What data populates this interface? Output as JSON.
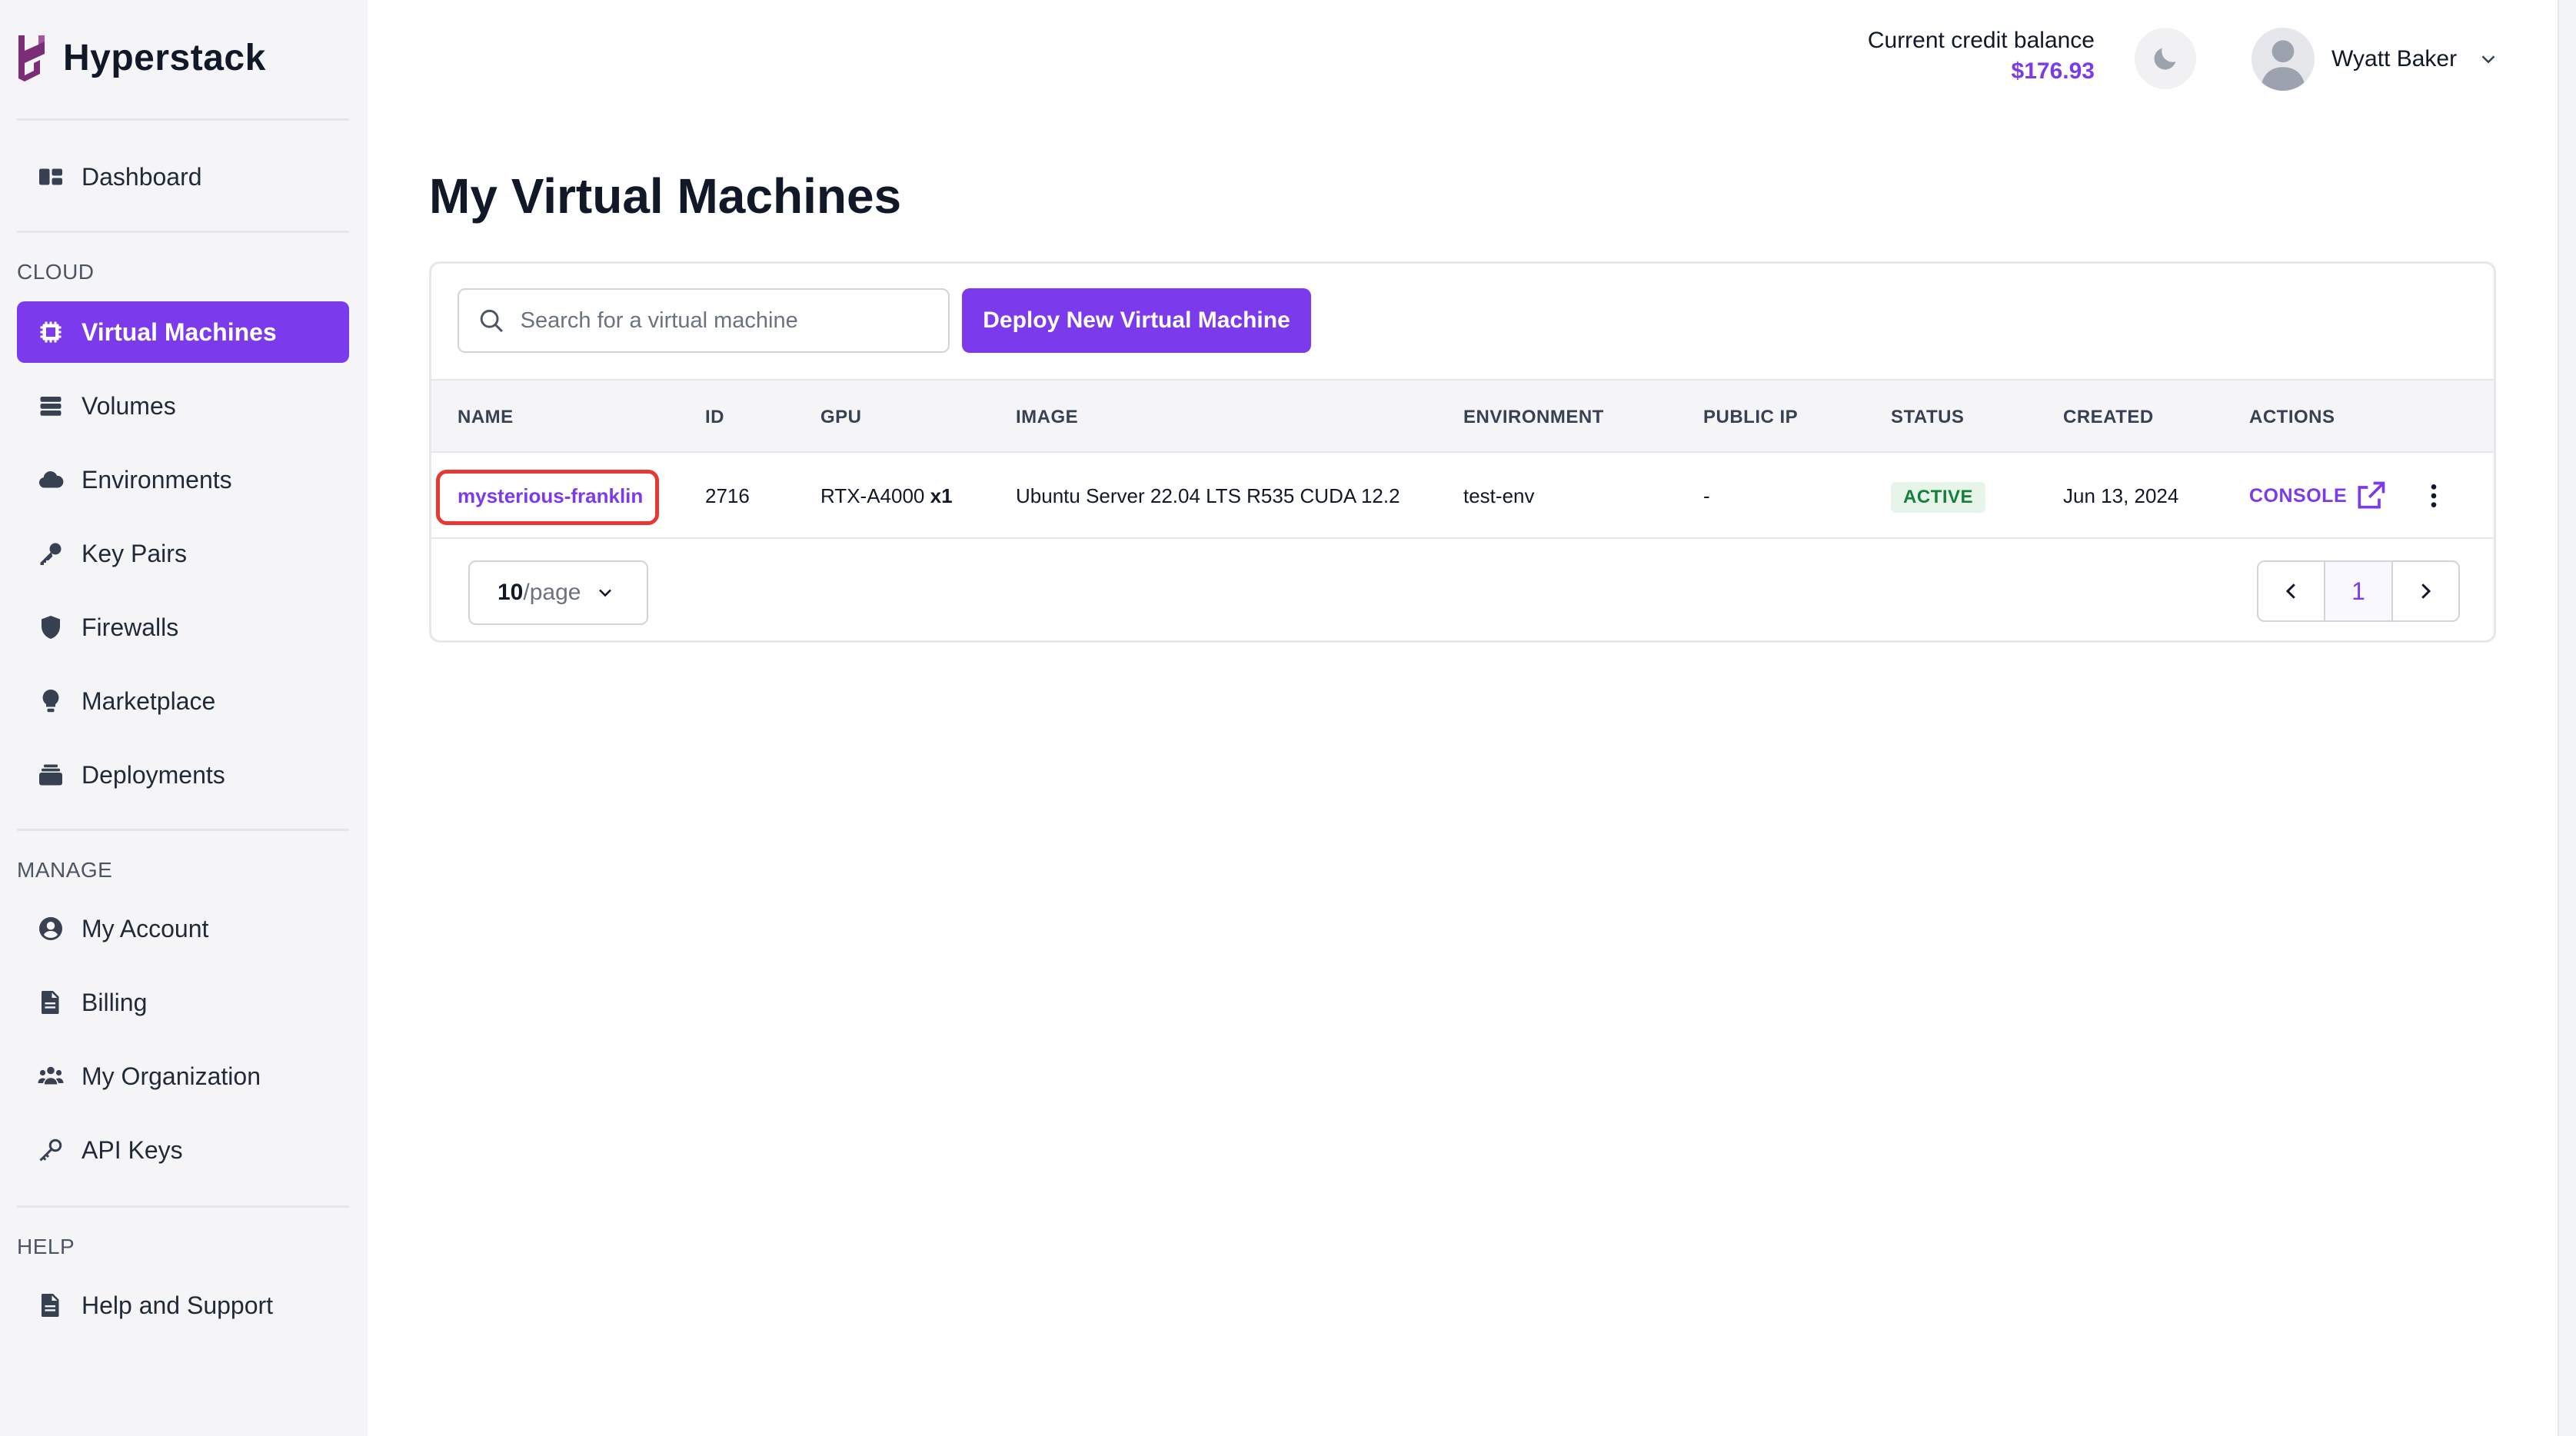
{
  "app": {
    "name": "Hyperstack"
  },
  "sidebar": {
    "sections": {
      "cloud": "CLOUD",
      "manage": "MANAGE",
      "help": "HELP"
    },
    "items": [
      {
        "label": "Dashboard",
        "icon": "dashboard-icon"
      },
      {
        "label": "Virtual Machines",
        "icon": "chip-icon",
        "active": true
      },
      {
        "label": "Volumes",
        "icon": "database-icon"
      },
      {
        "label": "Environments",
        "icon": "cloud-icon"
      },
      {
        "label": "Key Pairs",
        "icon": "key-icon"
      },
      {
        "label": "Firewalls",
        "icon": "shield-icon"
      },
      {
        "label": "Marketplace",
        "icon": "lightbulb-icon"
      },
      {
        "label": "Deployments",
        "icon": "layers-icon"
      },
      {
        "label": "My Account",
        "icon": "user-circle-icon"
      },
      {
        "label": "Billing",
        "icon": "document-icon"
      },
      {
        "label": "My Organization",
        "icon": "users-icon"
      },
      {
        "label": "API Keys",
        "icon": "key-outline-icon"
      },
      {
        "label": "Help and Support",
        "icon": "document-icon"
      }
    ]
  },
  "header": {
    "credit_label": "Current credit balance",
    "credit_value": "$176.93",
    "user_name": "Wyatt Baker"
  },
  "main": {
    "title": "My Virtual Machines",
    "search_placeholder": "Search for a virtual machine",
    "deploy_label": "Deploy New Virtual Machine",
    "columns": [
      "NAME",
      "ID",
      "GPU",
      "IMAGE",
      "ENVIRONMENT",
      "PUBLIC IP",
      "STATUS",
      "CREATED",
      "ACTIONS"
    ],
    "rows": [
      {
        "name": "mysterious-franklin",
        "id": "2716",
        "gpu": "RTX-A4000",
        "gpu_count": "x1",
        "image": "Ubuntu Server 22.04 LTS R535 CUDA 12.2",
        "environment": "test-env",
        "public_ip": "-",
        "status": "ACTIVE",
        "created": "Jun 13, 2024",
        "action": "CONSOLE"
      }
    ],
    "pagination": {
      "per_page_num": "10",
      "per_page_suffix": "/page",
      "current_page": "1"
    }
  },
  "colors": {
    "accent": "#7c3aed",
    "status_active_bg": "#e6f4ea",
    "status_active_text": "#15803d",
    "highlight": "#e53935"
  }
}
